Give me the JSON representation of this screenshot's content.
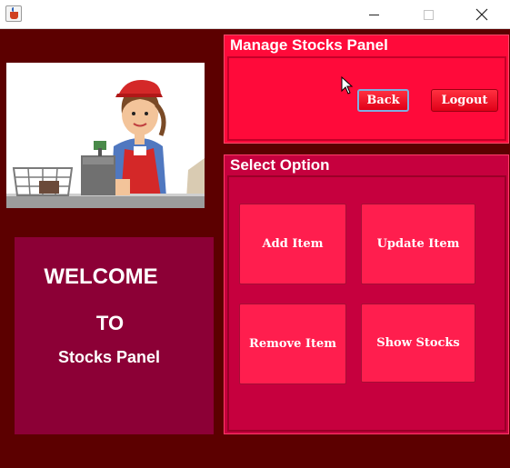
{
  "window": {
    "app_icon": "java-cup-icon",
    "controls": [
      "minimize-icon",
      "maximize-icon",
      "close-icon"
    ]
  },
  "image": {
    "subject": "cashier at checkout illustration"
  },
  "welcome": {
    "line1": "WELCOME",
    "line2": "TO",
    "line3": "Stocks Panel"
  },
  "manage_panel": {
    "title": "Manage Stocks Panel",
    "back_label": "Back",
    "logout_label": "Logout"
  },
  "select_panel": {
    "title": "Select Option",
    "options": [
      {
        "label": "Add Item"
      },
      {
        "label": "Update Item"
      },
      {
        "label": "Remove Item"
      },
      {
        "label": "Show Stocks"
      }
    ]
  },
  "colors": {
    "background": "#5c0000",
    "welcome_panel": "#8c0036",
    "manage_panel": "#ff0a3a",
    "select_panel": "#c6003e",
    "option_button": "#ff1e4e"
  }
}
